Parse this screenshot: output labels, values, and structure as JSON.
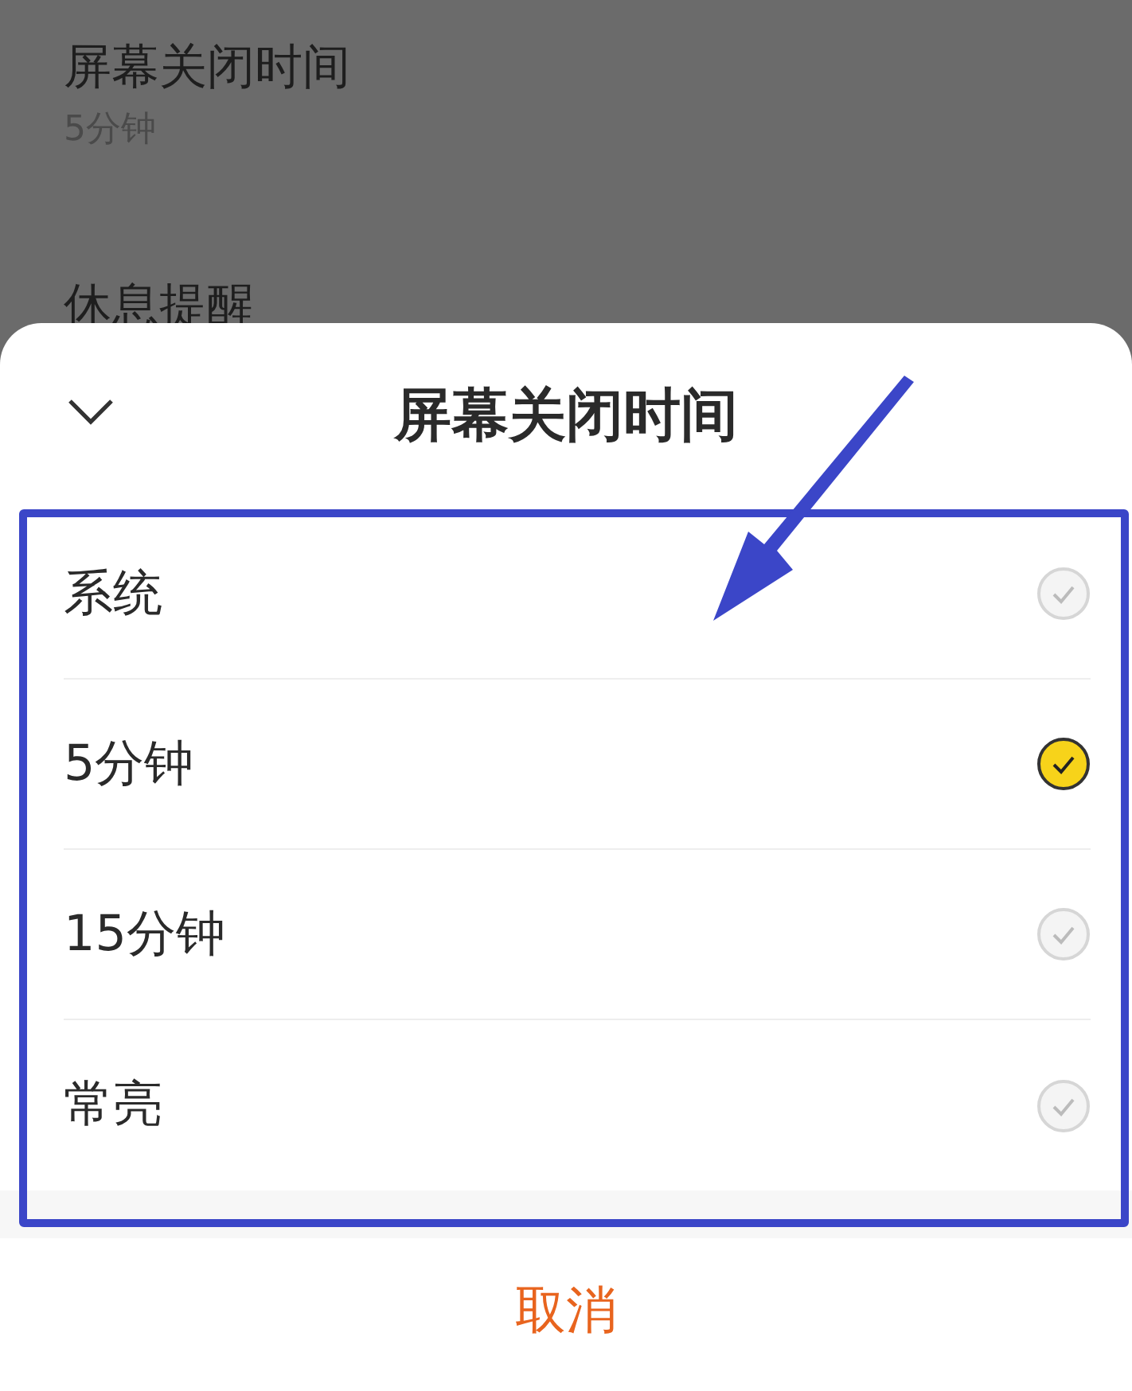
{
  "background": {
    "items": [
      {
        "title": "屏幕关闭时间",
        "value": "5分钟"
      },
      {
        "title": "休息提醒"
      }
    ]
  },
  "sheet": {
    "title": "屏幕关闭时间",
    "options": [
      {
        "label": "系统",
        "selected": false
      },
      {
        "label": "5分钟",
        "selected": true
      },
      {
        "label": "15分钟",
        "selected": false
      },
      {
        "label": "常亮",
        "selected": false
      }
    ],
    "cancel": "取消"
  }
}
